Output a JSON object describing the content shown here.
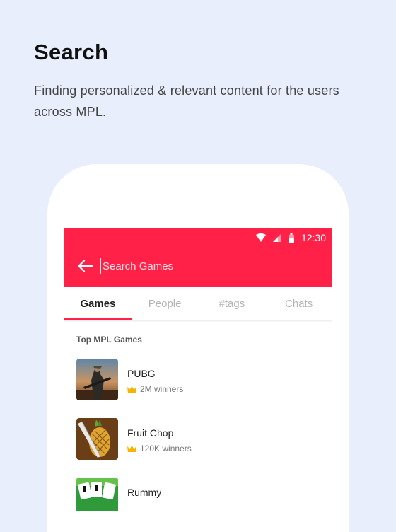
{
  "page": {
    "heading": "Search",
    "subtitle": "Finding personalized & relevant content for the users across MPL."
  },
  "statusbar": {
    "time": "12:30",
    "icons": [
      "wifi-icon",
      "signal-icon",
      "battery-icon"
    ]
  },
  "search": {
    "placeholder": "Search Games",
    "value": ""
  },
  "tabs": [
    {
      "label": "Games",
      "active": true
    },
    {
      "label": "People",
      "active": false
    },
    {
      "label": "#tags",
      "active": false
    },
    {
      "label": "Chats",
      "active": false
    }
  ],
  "section": {
    "title": "Top MPL Games"
  },
  "games": [
    {
      "name": "PUBG",
      "winners": "2M winners",
      "icon": "crown-icon"
    },
    {
      "name": "Fruit Chop",
      "winners": "120K winners",
      "icon": "crown-icon"
    },
    {
      "name": "Rummy",
      "winners": "",
      "icon": "crown-icon"
    }
  ],
  "colors": {
    "accent": "#ff2147",
    "background": "#e9eefc",
    "crown": "#f5b400"
  }
}
